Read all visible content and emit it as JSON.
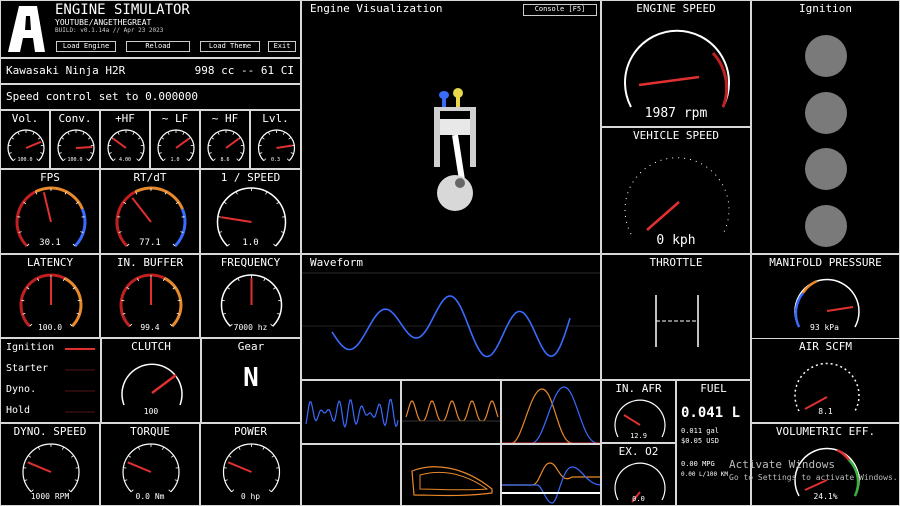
{
  "header": {
    "app_title": "ENGINE SIMULATOR",
    "channel": "YOUTUBE/ANGETHEGREAT",
    "build": "BUILD: v0.1.14a // Apr 23 2023",
    "buttons": [
      "Load Engine",
      "Reload",
      "Load Theme",
      "Exit"
    ]
  },
  "engine": {
    "name": "Kawasaki Ninja H2R",
    "displacement": "998 cc -- 61 CI"
  },
  "speed_control": "Speed control set to 0.000000",
  "small_gauges": [
    {
      "label": "Vol.",
      "value": "100.0",
      "level": 0.75
    },
    {
      "label": "Conv.",
      "value": "100.0",
      "level": 0.82
    },
    {
      "label": "+HF",
      "value": "4.00",
      "level": 0.3
    },
    {
      "label": "~ LF",
      "value": "1.0",
      "level": 0.7
    },
    {
      "label": "~ HF",
      "value": "8.6",
      "level": 0.7
    },
    {
      "label": "Lvl.",
      "value": "0.3",
      "level": 0.8
    }
  ],
  "mid_gauges": [
    {
      "label": "FPS",
      "value": "30.1",
      "level": 0.45
    },
    {
      "label": "RT/dT",
      "value": "77.1",
      "level": 0.36
    },
    {
      "label": "1 / SPEED",
      "value": "1.0",
      "level": 0.2
    }
  ],
  "row3_gauges": [
    {
      "label": "LATENCY",
      "value": "100.0",
      "level": 0.5
    },
    {
      "label": "IN. BUFFER",
      "value": "99.4",
      "level": 0.5
    },
    {
      "label": "FREQUENCY",
      "value": "7000 hz",
      "level": 0.5
    }
  ],
  "status": {
    "items": [
      "Ignition",
      "Starter",
      "Dyno.",
      "Hold"
    ],
    "clutch_label": "CLUTCH",
    "clutch_value": "100",
    "gear_label": "Gear",
    "gear_value": "N"
  },
  "bottom_gauges": [
    {
      "label": "DYNO. SPEED",
      "value": "1000 RPM",
      "level": 0.25
    },
    {
      "label": "TORQUE",
      "value": "0.0 Nm",
      "level": 0.25
    },
    {
      "label": "POWER",
      "value": "0 hp",
      "level": 0.25
    }
  ],
  "panels": {
    "engine_vis": "Engine Visualization",
    "console": "Console [F5]",
    "waveform": "Waveform",
    "throttle": "THROTTLE"
  },
  "engine_speed": {
    "label": "ENGINE SPEED",
    "value": "1987 rpm",
    "level": 0.42
  },
  "vehicle_speed": {
    "label": "VEHICLE SPEED",
    "value": "0 kph",
    "level": 0.2
  },
  "ignition": {
    "label": "Ignition"
  },
  "manifold": {
    "label": "MANIFOLD PRESSURE",
    "value": "93 kPa",
    "level": 0.48
  },
  "air_scfm": {
    "label": "AIR SCFM",
    "value": "8.1",
    "level": 0.3
  },
  "volumetric": {
    "label": "VOLUMETRIC EFF.",
    "value": "24.1%",
    "level": 0.3
  },
  "afr": {
    "label": "IN. AFR",
    "value": "12.9",
    "level": 0.35
  },
  "ex_o2": {
    "label": "EX. O2",
    "value": "0.0",
    "level": 0.3
  },
  "fuel": {
    "label": "FUEL",
    "liters": "0.041 L",
    "gal": "0.011 gal",
    "usd": "$0.05 USD",
    "mpg": "0.00 MPG",
    "l100": "0.00 L/100 KM"
  },
  "watermark": {
    "line1": "Activate Windows",
    "line2": "Go to Settings to activate Windows."
  },
  "colors": {
    "needle": "#e03030",
    "blue": "#3a6bff",
    "orange": "#e8892b",
    "red_arc": "#c02020"
  }
}
